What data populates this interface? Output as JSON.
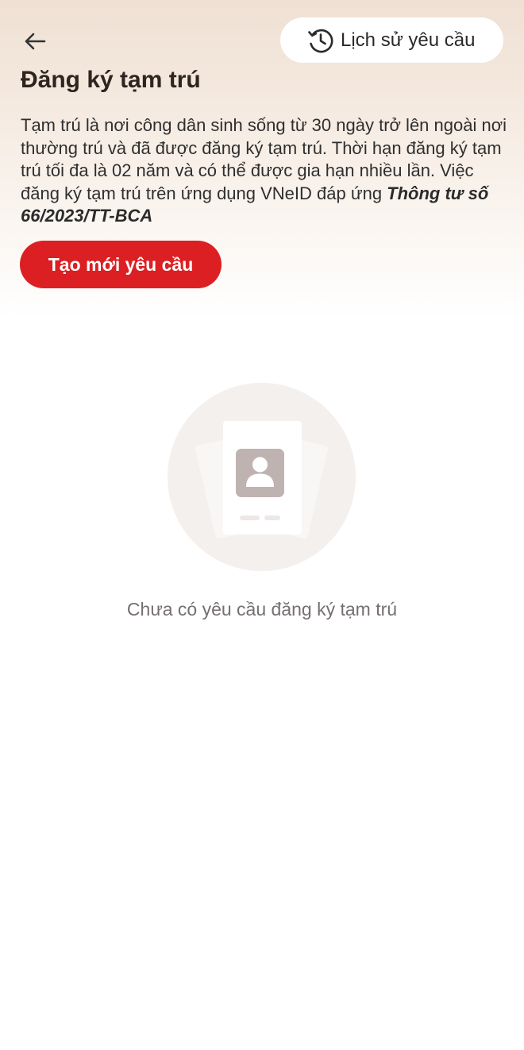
{
  "header": {
    "back_icon": "arrow-left-icon",
    "history_icon": "clock-history-icon",
    "history_label": "Lịch sử yêu cầu"
  },
  "page": {
    "title": "Đăng ký tạm trú",
    "description_text": "Tạm trú là nơi công dân sinh sống từ 30 ngày trở lên ngoài nơi thường trú và đã được đăng ký tạm trú. Thời hạn đăng ký tạm trú tối đa là 02 năm và có thể được gia hạn nhiều lần. Việc đăng ký tạm trú trên ứng dụng VNeID đáp ứng ",
    "description_legal_ref": "Thông tư số 66/2023/TT-BCA",
    "create_button_label": "Tạo mới yêu cầu"
  },
  "empty_state": {
    "illustration_icon": "id-card-person-icon",
    "message": "Chưa có yêu cầu đăng ký tạm trú"
  },
  "colors": {
    "primary_red": "#dc1f23",
    "header_gradient_top": "#efe0d3",
    "text_dark": "#2e2420",
    "text_muted": "#75706e"
  }
}
